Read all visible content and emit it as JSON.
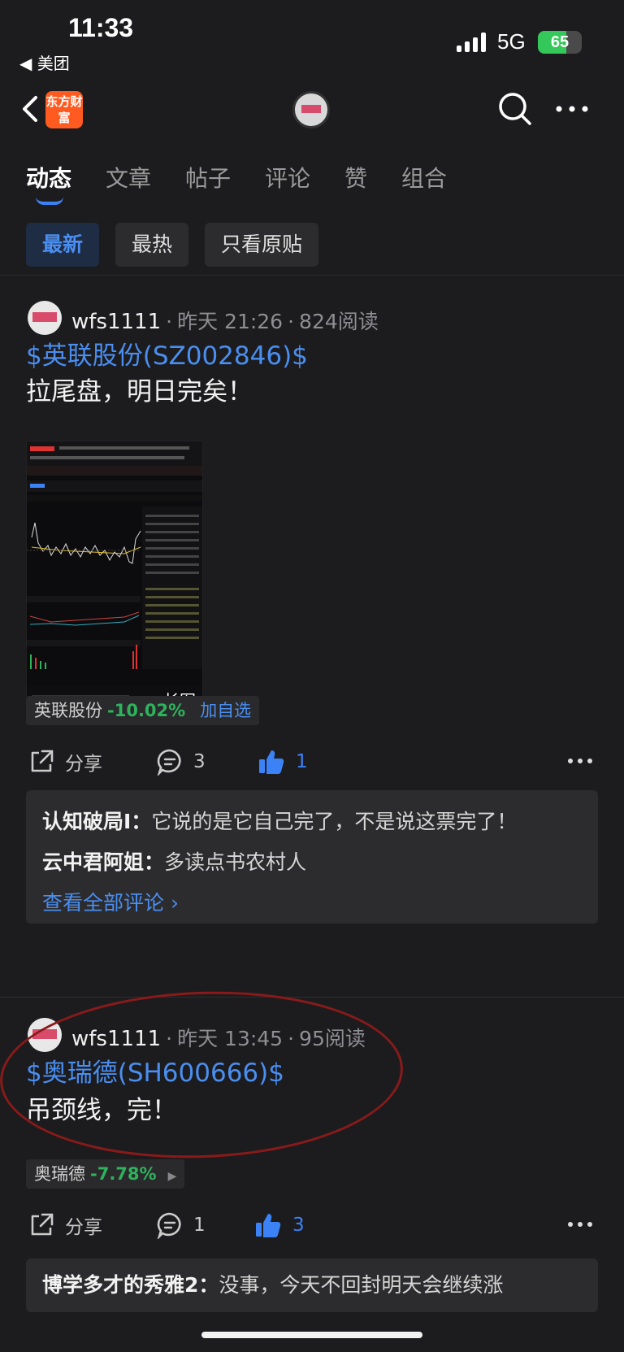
{
  "status_bar": {
    "time": "11:33",
    "back_app": "◀ 美团",
    "network": "5G",
    "battery": "65"
  },
  "nav": {
    "logo_text": "东方财富"
  },
  "tabs": [
    "动态",
    "文章",
    "帖子",
    "评论",
    "赞",
    "组合"
  ],
  "filters": [
    "最新",
    "最热",
    "只看原贴"
  ],
  "posts": [
    {
      "author": "wfs1111",
      "time": "昨天 21:26",
      "reads": "824阅读",
      "stock_link": "$英联股份(SZ002846)$",
      "text": "拉尾盘，明日完矣！",
      "image_tag": "长图",
      "stock": {
        "name": "英联股份",
        "change": "-10.02%",
        "action": "加自选"
      },
      "share_label": "分享",
      "comments_count": "3",
      "likes_count": "1",
      "comments": [
        {
          "user": "认知破局I：",
          "text": "它说的是它自己完了，不是说这票完了！"
        },
        {
          "user": "云中君阿姐：",
          "text": "多读点书农村人"
        }
      ],
      "view_all": "查看全部评论 ›"
    },
    {
      "author": "wfs1111",
      "time": "昨天 13:45",
      "reads": "95阅读",
      "stock_link": "$奥瑞德(SH600666)$",
      "text": "吊颈线，完！",
      "stock": {
        "name": "奥瑞德",
        "change": "-7.78%",
        "arrow": "▶"
      },
      "share_label": "分享",
      "comments_count": "1",
      "likes_count": "3",
      "comments": [
        {
          "user": "博学多才的秀雅2：",
          "text": "没事，今天不回封明天会继续涨"
        }
      ]
    }
  ]
}
